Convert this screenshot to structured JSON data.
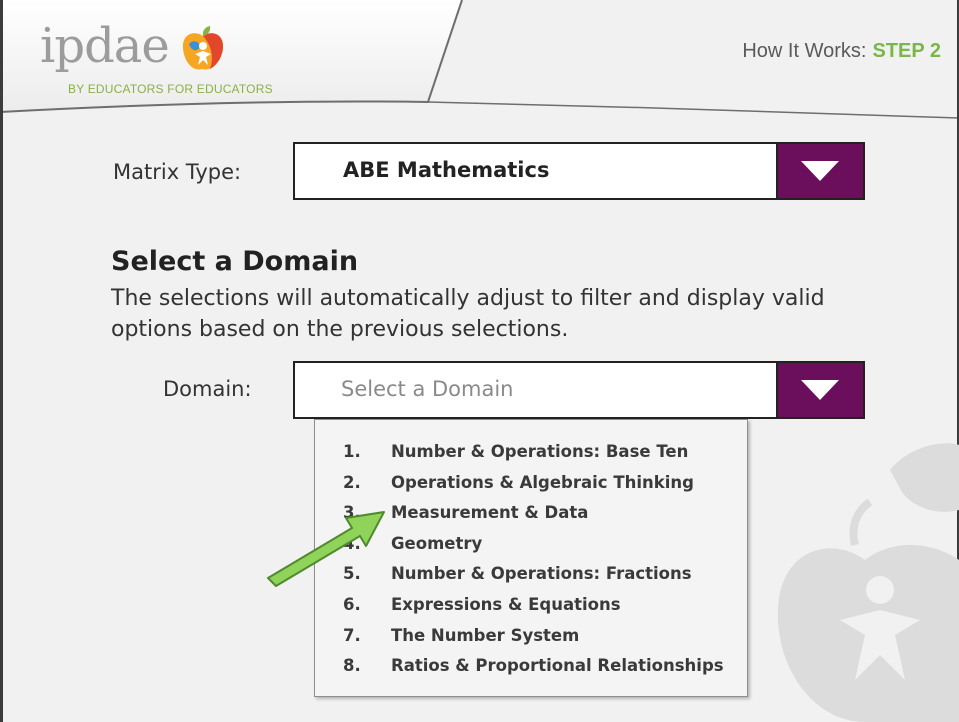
{
  "header": {
    "logo_word": "ipdae",
    "logo_tagline": "BY EDUCATORS FOR EDUCATORS",
    "step_prefix": "How It Works:",
    "step_label": "STEP 2"
  },
  "matrix": {
    "label": "Matrix Type:",
    "value": "ABE Mathematics"
  },
  "section": {
    "heading": "Select a Domain",
    "description": "The selections will automatically adjust to filter and display valid options based on the previous selections."
  },
  "domain": {
    "label": "Domain:",
    "placeholder": "Select a Domain",
    "options": [
      {
        "num": "1.",
        "label": "Number & Operations: Base Ten"
      },
      {
        "num": "2.",
        "label": "Operations & Algebraic Thinking"
      },
      {
        "num": "3.",
        "label": "Measurement & Data"
      },
      {
        "num": "4.",
        "label": "Geometry"
      },
      {
        "num": "5.",
        "label": "Number & Operations: Fractions"
      },
      {
        "num": "6.",
        "label": "Expressions & Equations"
      },
      {
        "num": "7.",
        "label": "The Number System"
      },
      {
        "num": "8.",
        "label": "Ratios & Proportional Relationships"
      }
    ]
  },
  "colors": {
    "accent_purple": "#6b0f5c",
    "accent_green": "#7ab648",
    "arrow_green": "#8fd35a"
  }
}
